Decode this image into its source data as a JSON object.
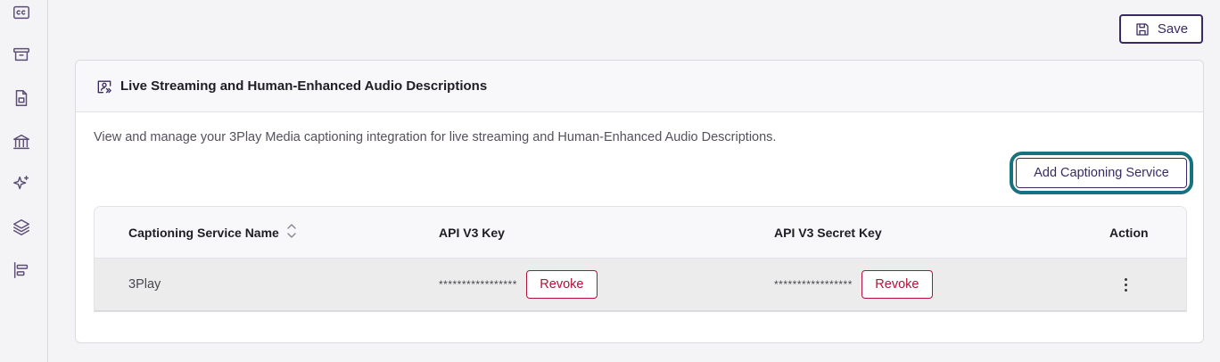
{
  "toolbar": {
    "save_label": "Save"
  },
  "sidebar": {
    "icons": [
      "closed-captions-icon",
      "archive-icon",
      "file-icon",
      "bank-icon",
      "sparkle-icon",
      "layers-icon",
      "align-left-icon"
    ]
  },
  "card": {
    "title": "Live Streaming and Human-Enhanced Audio Descriptions",
    "description": "View and manage your 3Play Media captioning integration for live streaming and Human-Enhanced Audio Descriptions.",
    "add_button_label": "Add Captioning Service"
  },
  "table": {
    "columns": [
      "Captioning Service Name",
      "API V3 Key",
      "API V3 Secret Key",
      "Action"
    ],
    "rows": [
      {
        "name": "3Play",
        "api_key": "*****************",
        "api_key_action": "Revoke",
        "secret_key": "*****************",
        "secret_key_action": "Revoke"
      }
    ]
  },
  "colors": {
    "accent": "#3a2a63",
    "focus_ring": "#16727e",
    "danger": "#b2123a"
  }
}
